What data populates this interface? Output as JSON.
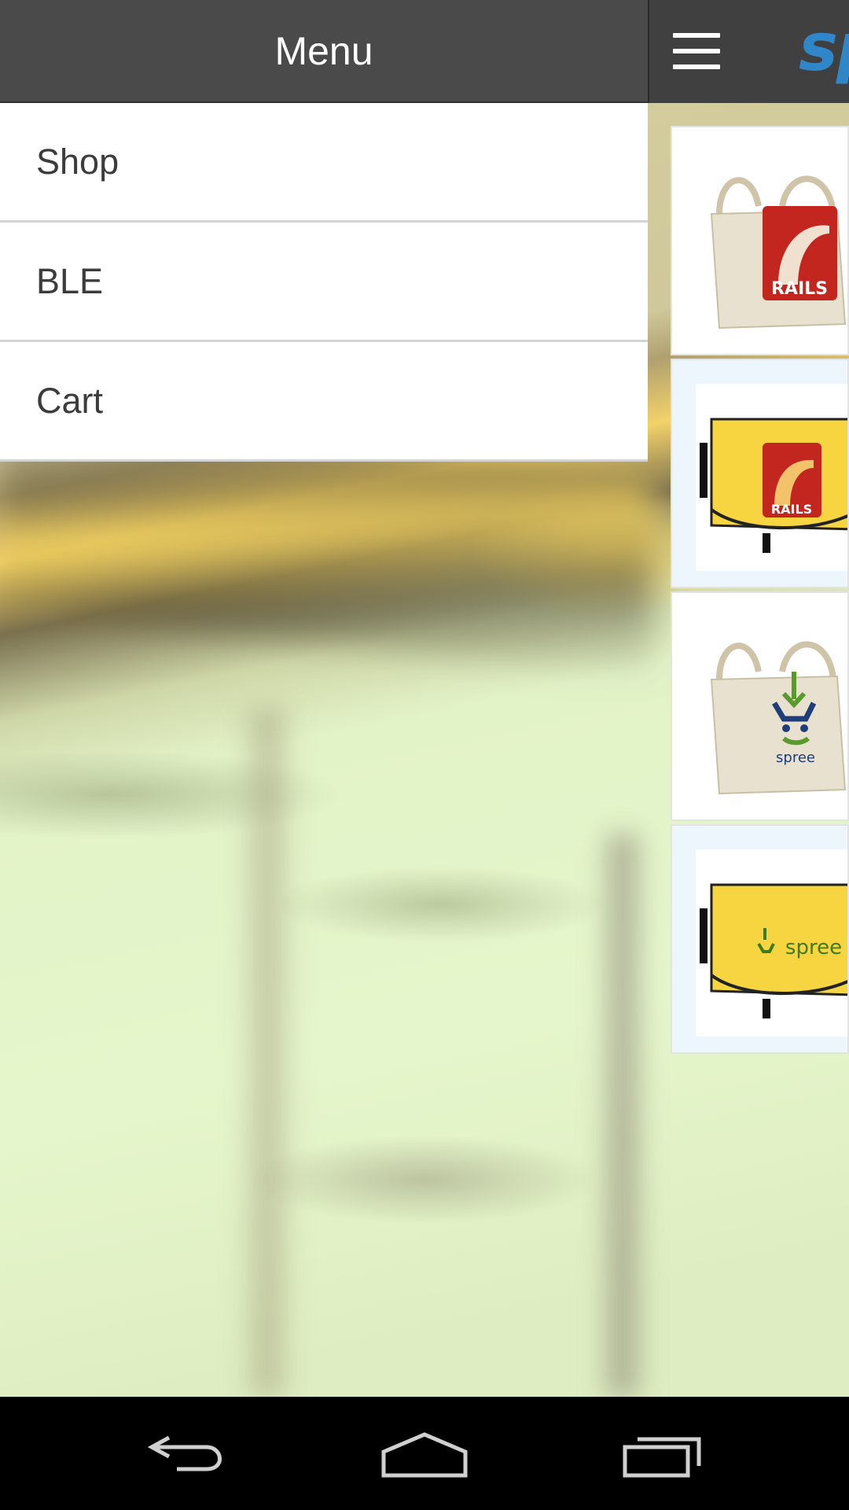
{
  "drawer": {
    "title": "Menu",
    "items": [
      {
        "label": "Shop"
      },
      {
        "label": "BLE"
      },
      {
        "label": "Cart"
      }
    ]
  },
  "app_bar": {
    "brand": "sp",
    "menu_icon": "hamburger-icon"
  },
  "products": [
    {
      "image": "rails-tote-bag"
    },
    {
      "image": "rails-messenger-bag"
    },
    {
      "image": "spree-tote-bag"
    },
    {
      "image": "spree-messenger-bag"
    }
  ],
  "nav": {
    "back_icon": "back-icon",
    "home_icon": "home-icon",
    "recents_icon": "recent-apps-icon"
  },
  "colors": {
    "drawer_header": "#4a4a4a",
    "brand_blue": "#2f87c9",
    "bag_yellow": "#f7d541",
    "rails_red": "#c3261f"
  }
}
